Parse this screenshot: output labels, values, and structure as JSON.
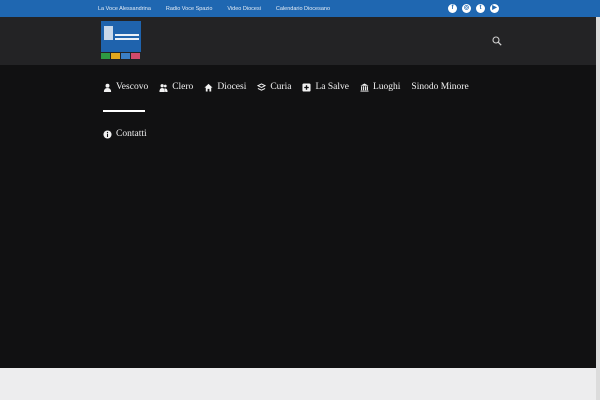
{
  "topbar": {
    "links": [
      "La Voce Alessandrina",
      "Radio Voce Spazio",
      "Video Diocesi",
      "Calendario Diocesano"
    ],
    "social": [
      {
        "icon": "facebook-icon",
        "glyph": "f"
      },
      {
        "icon": "instagram-icon",
        "glyph": "◎"
      },
      {
        "icon": "twitter-icon",
        "glyph": "t"
      },
      {
        "icon": "youtube-icon",
        "glyph": "▶"
      }
    ]
  },
  "header": {
    "logo_colors": [
      "#2e9a43",
      "#e2a71e",
      "#3b7fc6",
      "#d24a6b"
    ],
    "search_icon": "search-icon"
  },
  "nav": {
    "items": [
      {
        "label": "Vescovo",
        "icon": "person-icon"
      },
      {
        "label": "Clero",
        "icon": "people-icon"
      },
      {
        "label": "Diocesi",
        "icon": "home-icon"
      },
      {
        "label": "Curia",
        "icon": "curia-icon"
      },
      {
        "label": "La Salve",
        "icon": "plus-square-icon"
      },
      {
        "label": "Luoghi",
        "icon": "building-icon"
      },
      {
        "label": "Sinodo Minore",
        "icon": ""
      }
    ],
    "active": "Vescovo",
    "second_row": {
      "label": "Contatti",
      "icon": "info-icon"
    }
  },
  "colors": {
    "topbar": "#1f67b1",
    "header": "#232325",
    "main": "#111112",
    "footer": "#ededee"
  }
}
